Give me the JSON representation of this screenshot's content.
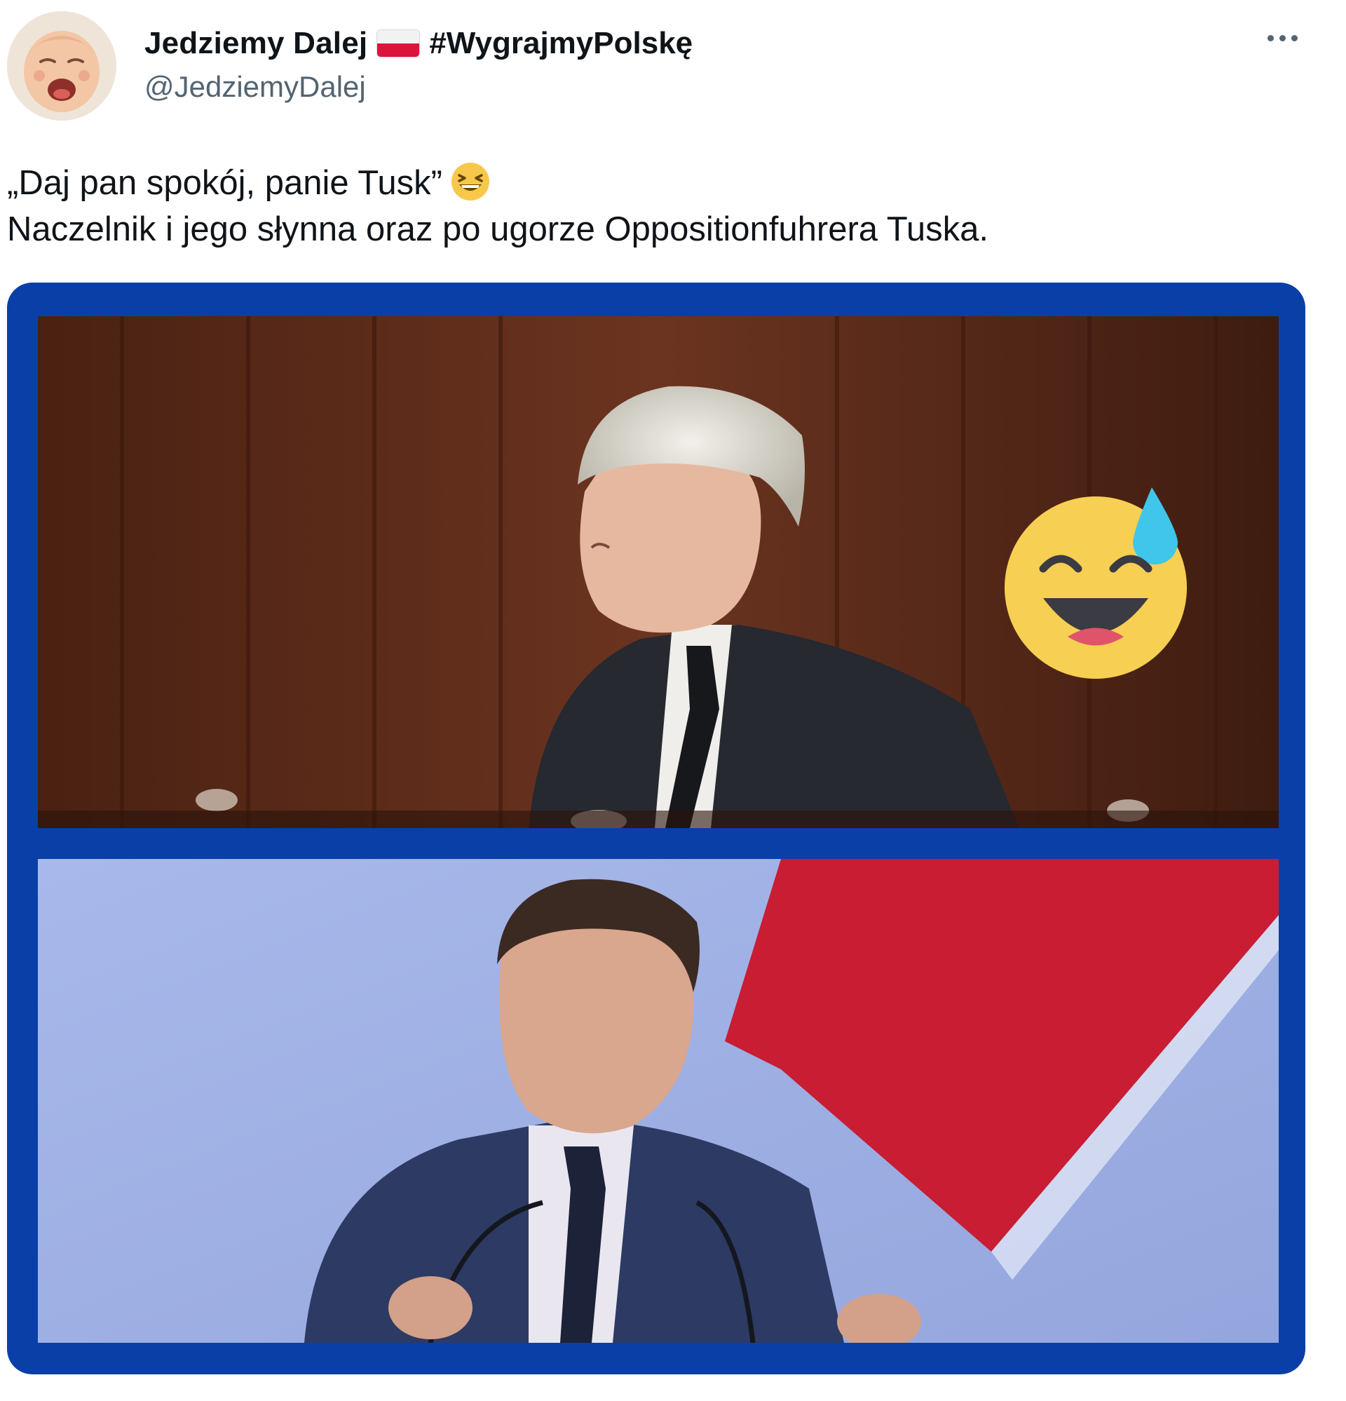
{
  "author": {
    "display_name": "Jedziemy Dalej",
    "flag_icon": "poland-flag-icon",
    "hashtag": "#WygrajmyPolskę",
    "handle": "@JedziemyDalej",
    "avatar_icon": "crying-baby-avatar"
  },
  "more_icon": "more-options-icon",
  "tweet": {
    "line1": "„Daj pan spokój, panie Tusk”",
    "line1_emoji": "grinning-squinting-face-emoji",
    "line2": "Naczelnik i jego słynna oraz po ugorze Oppositionfuhrera Tuska."
  },
  "media": {
    "frame_color": "#0a3fa8",
    "top_panel_emoji": "grinning-face-with-sweat-emoji"
  },
  "colors": {
    "text": "#0f1419",
    "secondary": "#536471",
    "flag_red": "#dc143c"
  }
}
